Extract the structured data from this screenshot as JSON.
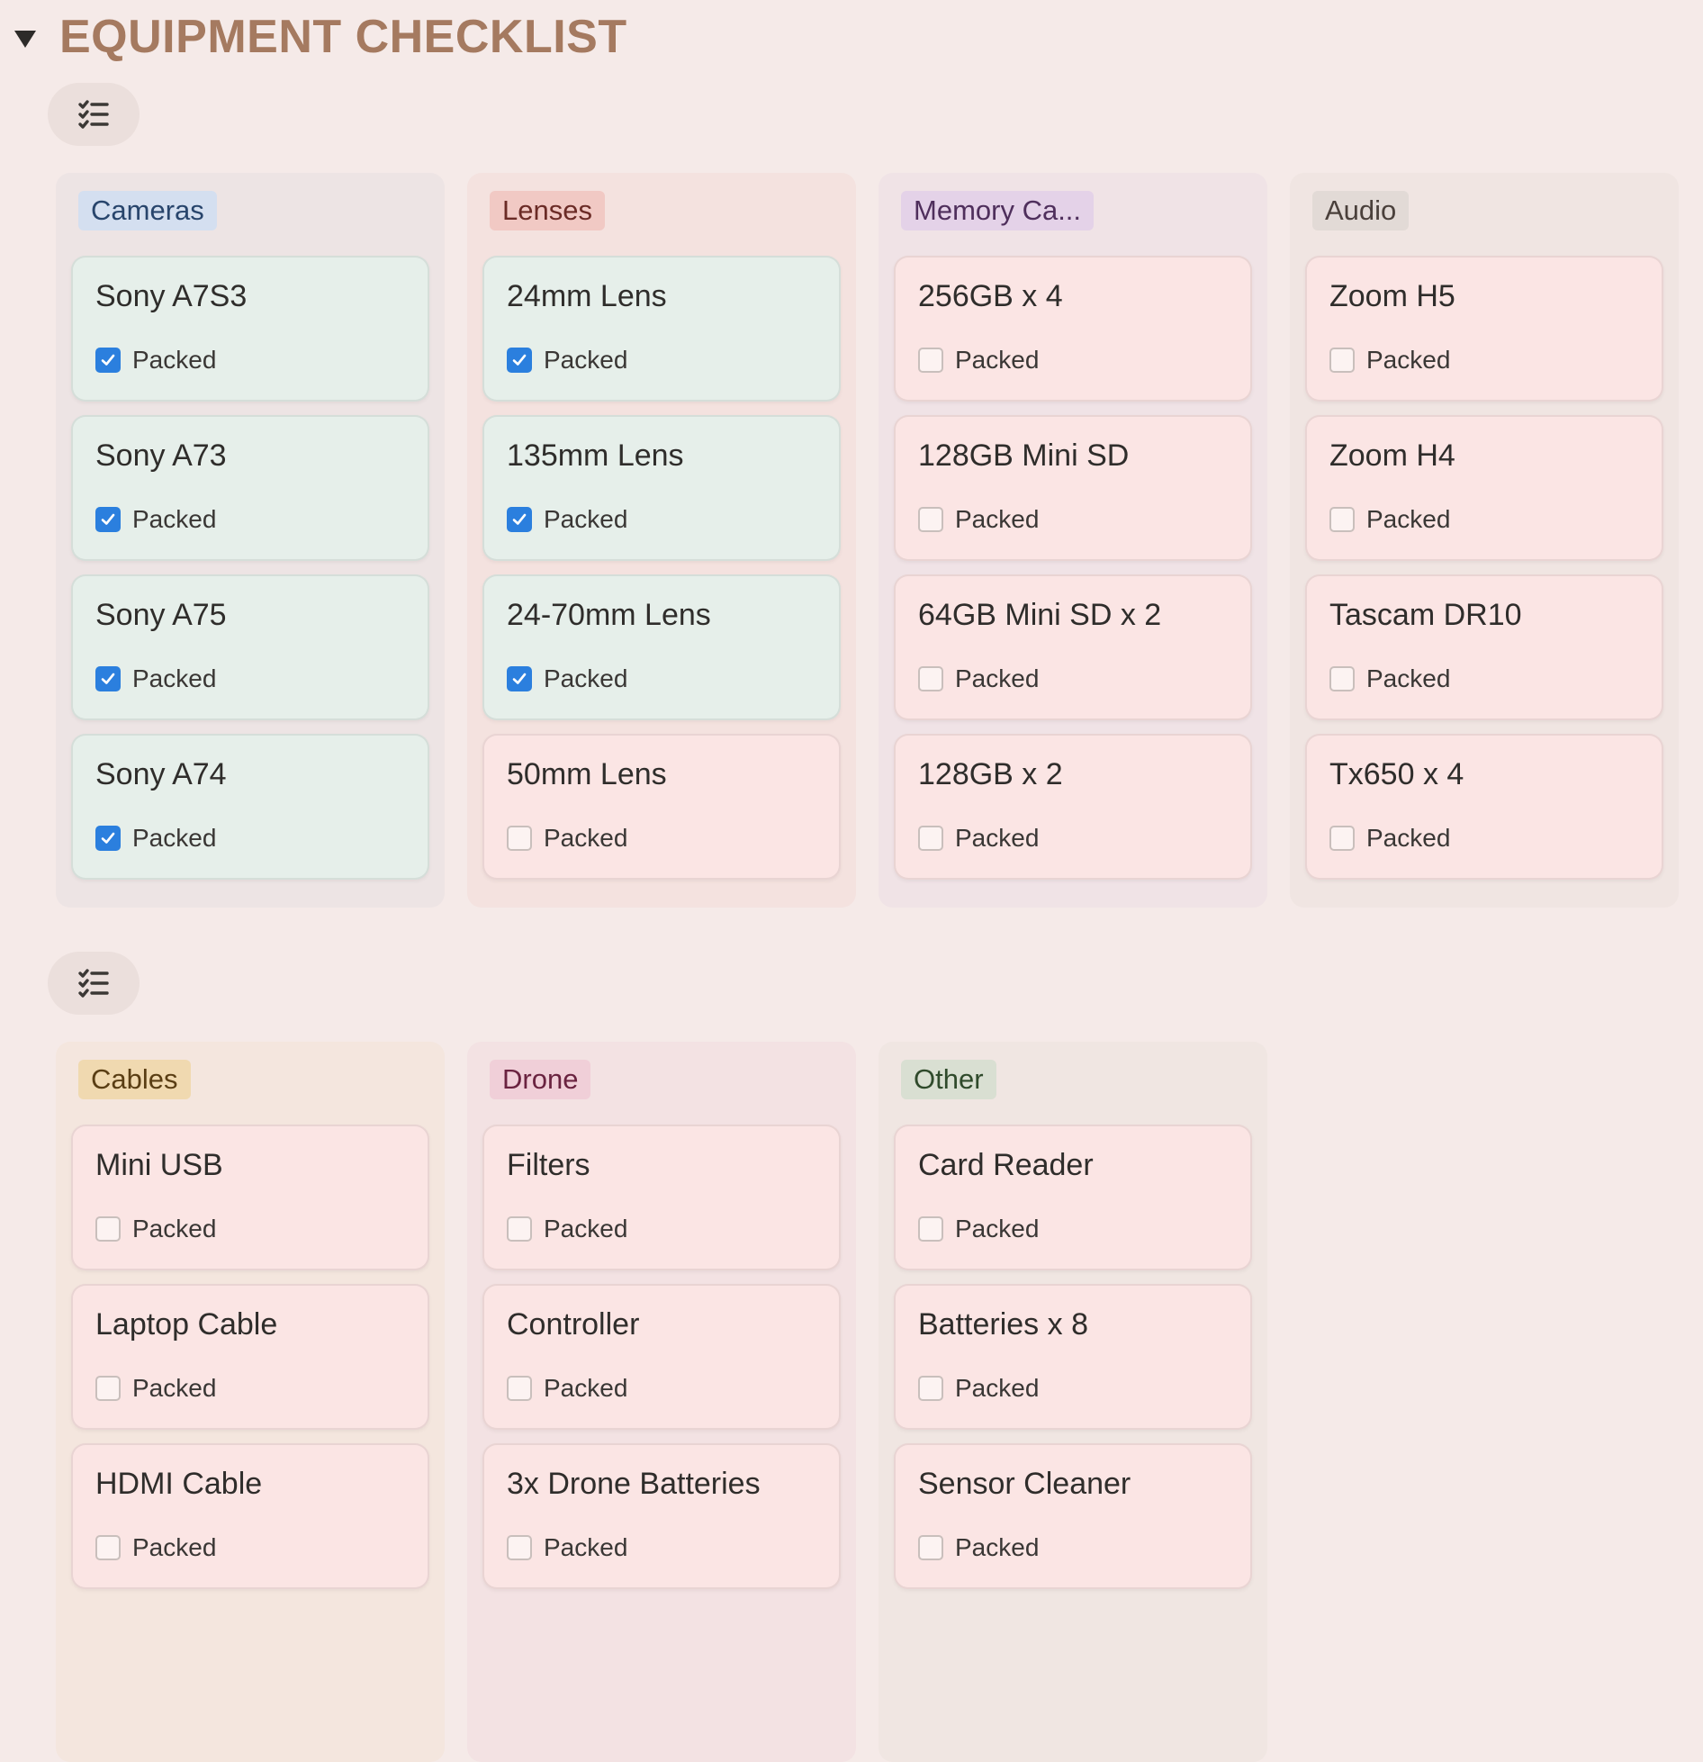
{
  "header": {
    "title": "EQUIPMENT CHECKLIST"
  },
  "view_button": {
    "icon": "checklist-icon"
  },
  "property_label": "Packed",
  "boards": [
    {
      "columns": [
        {
          "name": "Cameras",
          "tag_bg": "#d4dff0",
          "tag_fg": "#28456c",
          "col_bg": "#ede4e4",
          "cards": [
            {
              "title": "Sony A7S3",
              "packed": true
            },
            {
              "title": "Sony A73",
              "packed": true
            },
            {
              "title": "Sony A75",
              "packed": true
            },
            {
              "title": "Sony A74",
              "packed": true
            }
          ]
        },
        {
          "name": "Lenses",
          "tag_bg": "#f1c9c4",
          "tag_fg": "#6b2b26",
          "col_bg": "#f4e2df",
          "cards": [
            {
              "title": "24mm Lens",
              "packed": true
            },
            {
              "title": "135mm Lens",
              "packed": true
            },
            {
              "title": "24-70mm Lens",
              "packed": true
            },
            {
              "title": "50mm Lens",
              "packed": false
            }
          ]
        },
        {
          "name": "Memory Ca...",
          "tag_bg": "#e4d2e8",
          "tag_fg": "#4f2f5c",
          "col_bg": "#f0e3e6",
          "cards": [
            {
              "title": "256GB x 4",
              "packed": false
            },
            {
              "title": "128GB Mini SD",
              "packed": false
            },
            {
              "title": "64GB Mini SD x 2",
              "packed": false
            },
            {
              "title": "128GB x 2",
              "packed": false
            }
          ]
        },
        {
          "name": "Audio",
          "tag_bg": "#e2dad6",
          "tag_fg": "#4a403b",
          "col_bg": "#f0e5e2",
          "cards": [
            {
              "title": "Zoom H5",
              "packed": false
            },
            {
              "title": "Zoom H4",
              "packed": false
            },
            {
              "title": "Tascam DR10",
              "packed": false
            },
            {
              "title": "Tx650 x 4",
              "packed": false
            }
          ]
        }
      ]
    },
    {
      "columns": [
        {
          "name": "Cables",
          "tag_bg": "#f0d9b0",
          "tag_fg": "#5a3e14",
          "col_bg": "#f4e6de",
          "cards": [
            {
              "title": "Mini USB",
              "packed": false
            },
            {
              "title": "Laptop Cable",
              "packed": false
            },
            {
              "title": "HDMI Cable",
              "packed": false
            }
          ]
        },
        {
          "name": "Drone",
          "tag_bg": "#f0cfd8",
          "tag_fg": "#6a2340",
          "col_bg": "#f3e2e3",
          "cards": [
            {
              "title": "Filters",
              "packed": false
            },
            {
              "title": "Controller",
              "packed": false
            },
            {
              "title": "3x Drone Batteries",
              "packed": false
            }
          ]
        },
        {
          "name": "Other",
          "tag_bg": "#d9dfd2",
          "tag_fg": "#2f4a2b",
          "col_bg": "#f0e6e2",
          "cards": [
            {
              "title": "Card Reader",
              "packed": false
            },
            {
              "title": "Batteries x 8",
              "packed": false
            },
            {
              "title": "Sensor Cleaner",
              "packed": false
            }
          ]
        }
      ]
    }
  ]
}
